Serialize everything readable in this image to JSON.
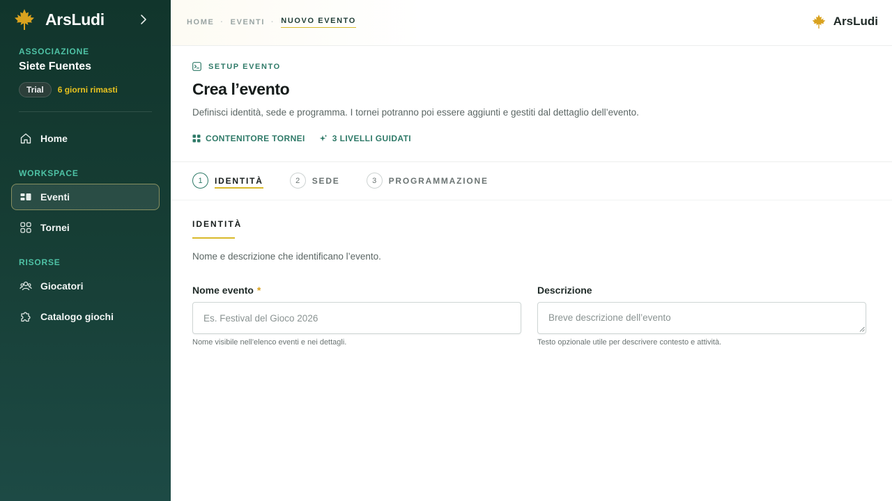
{
  "app": {
    "name": "ArsLudi"
  },
  "sidebar": {
    "org_section_label": "ASSOCIAZIONE",
    "org_name": "Siete Fuentes",
    "trial_badge": "Trial",
    "trial_days": "6 giorni rimasti",
    "home_label": "Home",
    "workspace_label": "WORKSPACE",
    "workspace_items": [
      {
        "label": "Eventi",
        "icon": "events-icon",
        "active": true
      },
      {
        "label": "Tornei",
        "icon": "grid-icon",
        "active": false
      }
    ],
    "resources_label": "RISORSE",
    "resources_items": [
      {
        "label": "Giocatori",
        "icon": "users-icon"
      },
      {
        "label": "Catalogo giochi",
        "icon": "puzzle-icon"
      }
    ]
  },
  "header": {
    "breadcrumbs": [
      "HOME",
      "EVENTI",
      "NUOVO EVENTO"
    ],
    "separator": "·"
  },
  "page": {
    "kicker": "SETUP EVENTO",
    "title": "Crea l’evento",
    "subtitle": "Definisci identità, sede e programma. I tornei potranno poi essere aggiunti e gestiti dal dettaglio dell’evento.",
    "meta": [
      "CONTENITORE TORNEI",
      "3 LIVELLI GUIDATI"
    ]
  },
  "steps": [
    {
      "num": "1",
      "label": "IDENTITÀ",
      "active": true
    },
    {
      "num": "2",
      "label": "SEDE",
      "active": false
    },
    {
      "num": "3",
      "label": "PROGRAMMAZIONE",
      "active": false
    }
  ],
  "section": {
    "title": "IDENTITÀ",
    "description": "Nome e descrizione che identificano l’evento."
  },
  "form": {
    "name": {
      "label": "Nome evento",
      "required_mark": "*",
      "placeholder": "Es. Festival del Gioco 2026",
      "value": "",
      "help": "Nome visibile nell’elenco eventi e nei dettagli."
    },
    "description": {
      "label": "Descrizione",
      "placeholder": "Breve descrizione dell’evento",
      "value": "",
      "help": "Testo opzionale utile per descrivere contesto e attività."
    }
  },
  "colors": {
    "sidebar_bg": "#163d34",
    "accent_teal": "#2f7a68",
    "accent_gold": "#d9b92a",
    "trial_text": "#e8c21f"
  }
}
